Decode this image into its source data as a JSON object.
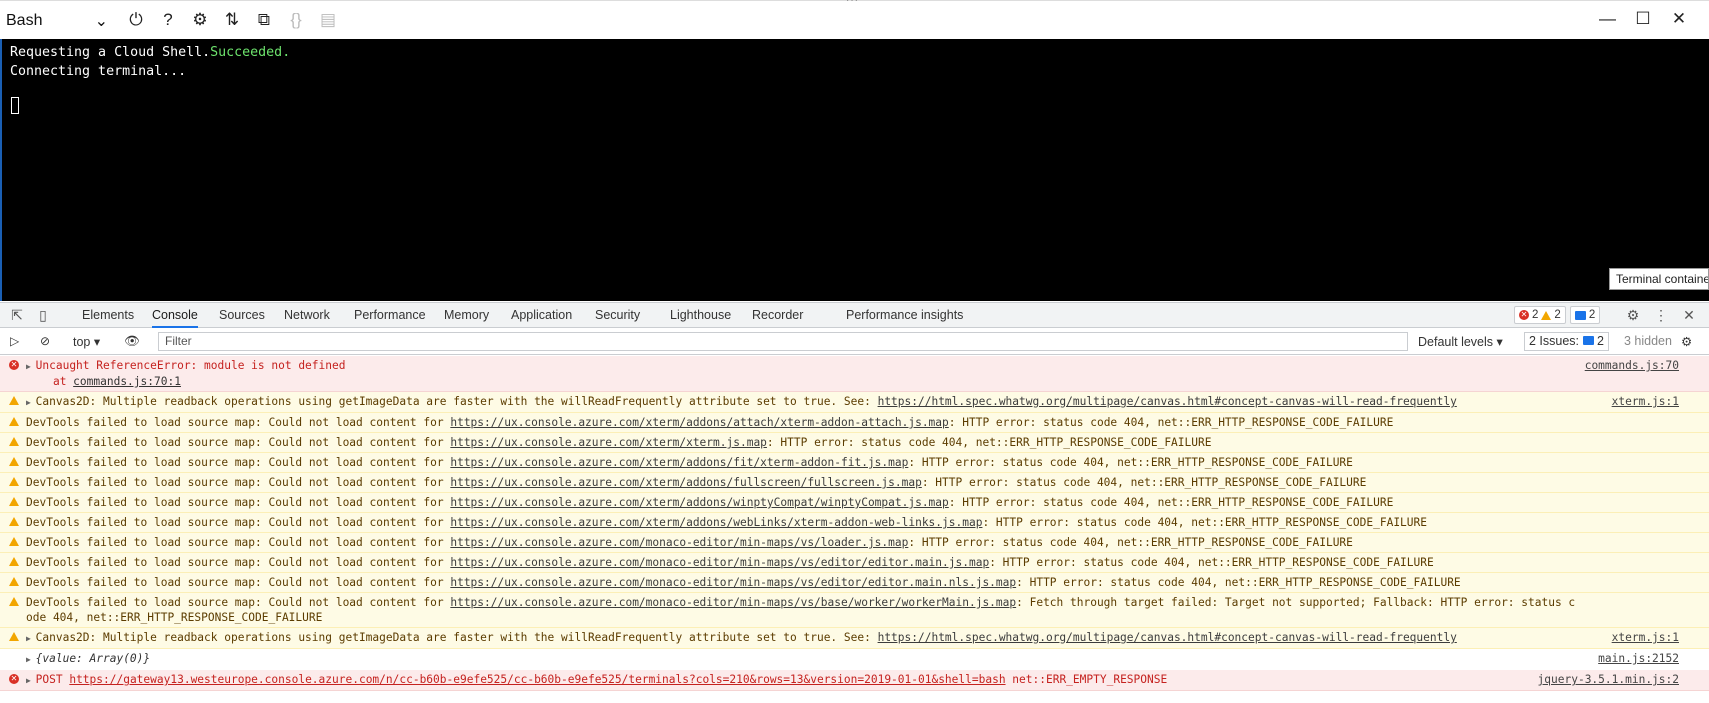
{
  "shell": {
    "selected": "Bash"
  },
  "terminal": {
    "line1_prefix": "Requesting a Cloud Shell.",
    "line1_status": "Succeeded.",
    "line2": "Connecting terminal..."
  },
  "tooltip": "Terminal containe",
  "devtools": {
    "tabs": [
      "Elements",
      "Console",
      "Sources",
      "Network",
      "Performance",
      "Memory",
      "Application",
      "Security",
      "Lighthouse",
      "Recorder",
      "Performance insights"
    ],
    "active_tab": "Console",
    "error_count": "2",
    "warning_count": "2",
    "message_count": "2"
  },
  "console_bar": {
    "context": "top",
    "filter_placeholder": "Filter",
    "levels": "Default levels",
    "issues_label": "2 Issues:",
    "issues_count": "2",
    "hidden": "3 hidden"
  },
  "log": [
    {
      "level": "error",
      "text": "Uncaught ReferenceError: module is not defined",
      "sub": "    at ",
      "sub_link": "commands.js:70:1",
      "source": "commands.js:70"
    },
    {
      "level": "warn",
      "pre": "Canvas2D: Multiple readback operations using getImageData are faster with the willReadFrequently attribute set to true. See: ",
      "link": "https://html.spec.whatwg.org/multipage/canvas.html#concept-canvas-will-read-frequently",
      "post": "",
      "source": "xterm.js:1"
    },
    {
      "level": "warn",
      "pre": "DevTools failed to load source map: Could not load content for ",
      "link": "https://ux.console.azure.com/xterm/addons/attach/xterm-addon-attach.js.map",
      "post": ": HTTP error: status code 404, net::ERR_HTTP_RESPONSE_CODE_FAILURE",
      "source": ""
    },
    {
      "level": "warn",
      "pre": "DevTools failed to load source map: Could not load content for ",
      "link": "https://ux.console.azure.com/xterm/xterm.js.map",
      "post": ": HTTP error: status code 404, net::ERR_HTTP_RESPONSE_CODE_FAILURE",
      "source": ""
    },
    {
      "level": "warn",
      "pre": "DevTools failed to load source map: Could not load content for ",
      "link": "https://ux.console.azure.com/xterm/addons/fit/xterm-addon-fit.js.map",
      "post": ": HTTP error: status code 404, net::ERR_HTTP_RESPONSE_CODE_FAILURE",
      "source": ""
    },
    {
      "level": "warn",
      "pre": "DevTools failed to load source map: Could not load content for ",
      "link": "https://ux.console.azure.com/xterm/addons/fullscreen/fullscreen.js.map",
      "post": ": HTTP error: status code 404, net::ERR_HTTP_RESPONSE_CODE_FAILURE",
      "source": ""
    },
    {
      "level": "warn",
      "pre": "DevTools failed to load source map: Could not load content for ",
      "link": "https://ux.console.azure.com/xterm/addons/winptyCompat/winptyCompat.js.map",
      "post": ": HTTP error: status code 404, net::ERR_HTTP_RESPONSE_CODE_FAILURE",
      "source": ""
    },
    {
      "level": "warn",
      "pre": "DevTools failed to load source map: Could not load content for ",
      "link": "https://ux.console.azure.com/xterm/addons/webLinks/xterm-addon-web-links.js.map",
      "post": ": HTTP error: status code 404, net::ERR_HTTP_RESPONSE_CODE_FAILURE",
      "source": ""
    },
    {
      "level": "warn",
      "pre": "DevTools failed to load source map: Could not load content for ",
      "link": "https://ux.console.azure.com/monaco-editor/min-maps/vs/loader.js.map",
      "post": ": HTTP error: status code 404, net::ERR_HTTP_RESPONSE_CODE_FAILURE",
      "source": ""
    },
    {
      "level": "warn",
      "pre": "DevTools failed to load source map: Could not load content for ",
      "link": "https://ux.console.azure.com/monaco-editor/min-maps/vs/editor/editor.main.js.map",
      "post": ": HTTP error: status code 404, net::ERR_HTTP_RESPONSE_CODE_FAILURE",
      "source": ""
    },
    {
      "level": "warn",
      "pre": "DevTools failed to load source map: Could not load content for ",
      "link": "https://ux.console.azure.com/monaco-editor/min-maps/vs/editor/editor.main.nls.js.map",
      "post": ": HTTP error: status code 404, net::ERR_HTTP_RESPONSE_CODE_FAILURE",
      "source": ""
    },
    {
      "level": "warn",
      "pre": "DevTools failed to load source map: Could not load content for ",
      "link": "https://ux.console.azure.com/monaco-editor/min-maps/vs/base/worker/workerMain.js.map",
      "post": ": Fetch through target failed: Target not supported; Fallback: HTTP error: status code 404, net::ERR_HTTP_RESPONSE_CODE_FAILURE",
      "source": ""
    },
    {
      "level": "warn",
      "pre": "Canvas2D: Multiple readback operations using getImageData are faster with the willReadFrequently attribute set to true. See: ",
      "link": "https://html.spec.whatwg.org/multipage/canvas.html#concept-canvas-will-read-frequently",
      "post": "",
      "source": "xterm.js:1"
    },
    {
      "level": "info",
      "pre": "{value: Array(0)}",
      "link": "",
      "post": "",
      "source": "main.js:2152"
    },
    {
      "level": "error",
      "pre": "POST ",
      "link": "https://gateway13.westeurope.console.azure.com/n/cc-b60b-e9efe525/cc-b60b-e9efe525/terminals?cols=210&rows=13&version=2019-01-01&shell=bash",
      "post": " net::ERR_EMPTY_RESPONSE",
      "source": "jquery-3.5.1.min.js:2"
    }
  ]
}
